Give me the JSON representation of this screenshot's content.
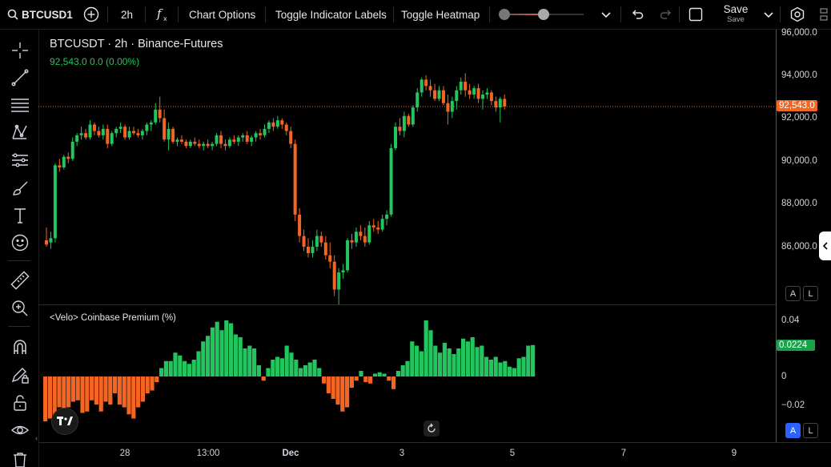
{
  "header": {
    "symbol": "BTCUSD1",
    "interval": "2h",
    "fx_label": "fx",
    "chart_options": "Chart Options",
    "toggle_indicator_labels": "Toggle Indicator Labels",
    "toggle_heatmap": "Toggle Heatmap",
    "save_label": "Save",
    "save_sub": "Save"
  },
  "legend": {
    "title": "BTCUSDT · 2h · Binance-Futures",
    "price_line": "92,543.0  0.0 (0.00%)"
  },
  "indicator": {
    "title": "<Velo> Coinbase Premium (%)",
    "current": "0.0224"
  },
  "price_axis": {
    "labels": [
      "96,000.0",
      "94,000.0",
      "92,000.0",
      "90,000.0",
      "88,000.0",
      "86,000.0"
    ],
    "current": "92,543.0"
  },
  "indicator_axis": {
    "labels": [
      "0.04",
      "0",
      "−0.02"
    ]
  },
  "time_axis": {
    "labels": [
      "28",
      "13:00",
      "Dec",
      "3",
      "5",
      "7",
      "9"
    ]
  },
  "buttons": {
    "auto": "A",
    "log": "L"
  },
  "colors": {
    "up": "#22c55e",
    "down": "#f26522",
    "current_price_badge": "#f26522",
    "current_ind_badge": "#16a34a",
    "auto_active": "#2962ff"
  },
  "chart_data": {
    "type": "candlestick",
    "symbol": "BTCUSDT",
    "interval": "2h",
    "exchange": "Binance-Futures",
    "ylim": [
      82800,
      96000
    ],
    "candles": [
      [
        86300,
        86900,
        86000,
        86100
      ],
      [
        86200,
        86700,
        85900,
        86400
      ],
      [
        86400,
        89900,
        86200,
        89800
      ],
      [
        89800,
        90100,
        89500,
        89700
      ],
      [
        89700,
        90300,
        89600,
        90200
      ],
      [
        90200,
        90400,
        89900,
        90100
      ],
      [
        90100,
        91100,
        90000,
        90900
      ],
      [
        90900,
        91300,
        90700,
        91200
      ],
      [
        91200,
        91600,
        91000,
        91300
      ],
      [
        91300,
        91500,
        91000,
        91100
      ],
      [
        91100,
        91900,
        91000,
        91700
      ],
      [
        91700,
        91800,
        91200,
        91400
      ],
      [
        91400,
        91600,
        91100,
        91200
      ],
      [
        91200,
        91700,
        91000,
        91500
      ],
      [
        91500,
        91700,
        90600,
        90800
      ],
      [
        90800,
        91400,
        90700,
        91300
      ],
      [
        91300,
        91600,
        91100,
        91500
      ],
      [
        91500,
        91800,
        91300,
        91600
      ],
      [
        91600,
        91700,
        91000,
        91100
      ],
      [
        91100,
        91600,
        91000,
        91400
      ],
      [
        91400,
        91600,
        91200,
        91300
      ],
      [
        91300,
        91500,
        91100,
        91200
      ],
      [
        91200,
        91500,
        91000,
        91400
      ],
      [
        91400,
        91800,
        91200,
        91700
      ],
      [
        91700,
        91900,
        91400,
        91800
      ],
      [
        91800,
        92700,
        91700,
        92400
      ],
      [
        92400,
        93000,
        91800,
        92000
      ],
      [
        92000,
        92400,
        90900,
        91000
      ],
      [
        91000,
        91800,
        90500,
        91500
      ],
      [
        91500,
        91600,
        90800,
        90900
      ],
      [
        90900,
        91100,
        90700,
        91000
      ],
      [
        91000,
        91200,
        90800,
        90900
      ],
      [
        90900,
        91000,
        90600,
        90700
      ],
      [
        90700,
        91000,
        90600,
        90900
      ],
      [
        90900,
        91100,
        90700,
        90800
      ],
      [
        90800,
        91000,
        90600,
        90700
      ],
      [
        90700,
        90900,
        90500,
        90800
      ],
      [
        90800,
        91000,
        90600,
        90700
      ],
      [
        90700,
        90900,
        90500,
        90800
      ],
      [
        90800,
        91300,
        90700,
        91200
      ],
      [
        91200,
        91400,
        90600,
        90800
      ],
      [
        90800,
        91000,
        90500,
        90700
      ],
      [
        90700,
        91100,
        90600,
        91000
      ],
      [
        91000,
        91200,
        90800,
        90900
      ],
      [
        90900,
        91200,
        90700,
        91100
      ],
      [
        91100,
        91300,
        90900,
        91200
      ],
      [
        91200,
        91400,
        90800,
        90900
      ],
      [
        90900,
        91200,
        90700,
        91100
      ],
      [
        91100,
        91400,
        90900,
        91300
      ],
      [
        91300,
        91500,
        91000,
        91200
      ],
      [
        91200,
        91700,
        91100,
        91500
      ],
      [
        91500,
        91900,
        91300,
        91800
      ],
      [
        91800,
        92000,
        91400,
        91600
      ],
      [
        91600,
        92100,
        91500,
        91900
      ],
      [
        91900,
        92000,
        91500,
        91700
      ],
      [
        91700,
        91800,
        91200,
        91400
      ],
      [
        91400,
        91600,
        90600,
        90800
      ],
      [
        90800,
        91000,
        87200,
        87500
      ],
      [
        87500,
        87800,
        86200,
        86500
      ],
      [
        86500,
        86800,
        85800,
        86000
      ],
      [
        86000,
        86400,
        85500,
        85700
      ],
      [
        85700,
        86300,
        85500,
        86000
      ],
      [
        86000,
        86800,
        85800,
        86500
      ],
      [
        86500,
        86700,
        86000,
        86200
      ],
      [
        86200,
        86500,
        85400,
        85600
      ],
      [
        85600,
        86200,
        85000,
        85300
      ],
      [
        85300,
        85600,
        83700,
        84000
      ],
      [
        84000,
        85000,
        83300,
        84800
      ],
      [
        84800,
        85200,
        84500,
        84900
      ],
      [
        84900,
        86400,
        84800,
        86300
      ],
      [
        86300,
        86600,
        85900,
        86200
      ],
      [
        86200,
        86900,
        86000,
        86700
      ],
      [
        86700,
        87000,
        86300,
        86500
      ],
      [
        86500,
        86900,
        86000,
        86200
      ],
      [
        86200,
        87200,
        86100,
        87000
      ],
      [
        87000,
        87300,
        86700,
        86900
      ],
      [
        86900,
        87200,
        86600,
        86800
      ],
      [
        86800,
        87500,
        86700,
        87300
      ],
      [
        87300,
        87700,
        87000,
        87500
      ],
      [
        87500,
        90800,
        87400,
        90600
      ],
      [
        90600,
        91800,
        90500,
        91600
      ],
      [
        91600,
        92000,
        91200,
        91400
      ],
      [
        91400,
        92300,
        91100,
        92100
      ],
      [
        92100,
        92200,
        91600,
        91700
      ],
      [
        91700,
        92600,
        91600,
        92500
      ],
      [
        92500,
        93400,
        92300,
        93200
      ],
      [
        93200,
        93900,
        93000,
        93800
      ],
      [
        93800,
        94000,
        93300,
        93500
      ],
      [
        93500,
        93800,
        93000,
        93300
      ],
      [
        93300,
        93600,
        92800,
        92900
      ],
      [
        92900,
        93500,
        92800,
        93300
      ],
      [
        93300,
        93500,
        92600,
        92700
      ],
      [
        92700,
        93100,
        91700,
        92300
      ],
      [
        92300,
        93000,
        92000,
        92800
      ],
      [
        92800,
        93500,
        92400,
        93300
      ],
      [
        93300,
        93900,
        93100,
        93700
      ],
      [
        93700,
        94100,
        93000,
        93300
      ],
      [
        93300,
        93600,
        92900,
        93100
      ],
      [
        93100,
        93500,
        92900,
        93400
      ],
      [
        93400,
        93600,
        92700,
        92900
      ],
      [
        92900,
        93300,
        92400,
        93100
      ],
      [
        93100,
        93400,
        92900,
        93200
      ],
      [
        93200,
        93300,
        92600,
        92800
      ],
      [
        92800,
        93000,
        92300,
        92500
      ],
      [
        92500,
        93000,
        91800,
        92900
      ],
      [
        92900,
        93100,
        92400,
        92543
      ]
    ],
    "premium": [
      -0.032,
      -0.03,
      -0.033,
      -0.022,
      -0.024,
      -0.022,
      -0.018,
      -0.017,
      -0.026,
      -0.025,
      -0.017,
      -0.02,
      -0.025,
      -0.018,
      -0.02,
      -0.012,
      -0.02,
      -0.022,
      -0.027,
      -0.03,
      -0.022,
      -0.018,
      -0.012,
      -0.01,
      -0.004,
      0.006,
      0.011,
      0.011,
      0.017,
      0.015,
      0.011,
      0.009,
      0.012,
      0.018,
      0.025,
      0.029,
      0.035,
      0.039,
      0.033,
      0.04,
      0.038,
      0.03,
      0.028,
      0.02,
      0.022,
      0.02,
      0.008,
      -0.003,
      0.006,
      0.012,
      0.014,
      0.013,
      0.022,
      0.017,
      0.012,
      0.006,
      0.008,
      0.01,
      0.012,
      0.006,
      -0.005,
      -0.012,
      -0.016,
      -0.02,
      -0.025,
      -0.022,
      -0.008,
      -0.003,
      0.004,
      -0.004,
      -0.005,
      0.002,
      0.003,
      0.002,
      -0.003,
      -0.009,
      0.004,
      0.008,
      0.011,
      0.025,
      0.022,
      0.018,
      0.04,
      0.033,
      0.022,
      0.017,
      0.024,
      0.02,
      0.016,
      0.02,
      0.027,
      0.025,
      0.028,
      0.021,
      0.022,
      0.014,
      0.012,
      0.014,
      0.01,
      0.011,
      0.007,
      0.006,
      0.013,
      0.014,
      0.022,
      0.0224
    ]
  }
}
